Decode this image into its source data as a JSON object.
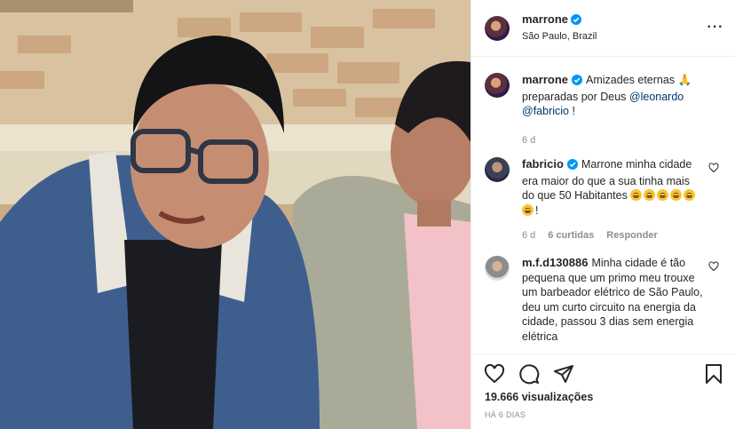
{
  "post": {
    "author": "marrone",
    "location": "São Paulo, Brazil",
    "more_icon": "more-options-icon",
    "caption": {
      "user": "marrone",
      "text_before": "Amizades eternas 🙏 preparadas por Deus ",
      "mention1": "@leonardo",
      "mention2": "@fabricio",
      "text_after": " !",
      "age": "6 d"
    },
    "comments": [
      {
        "user": "fabricio",
        "text": "Marrone minha cidade era maior do que a sua tinha mais do que 50 Habitantes",
        "text_end": "!",
        "age": "6 d",
        "likes": "6 curtidas",
        "reply": "Responder"
      },
      {
        "user": "m.f.d130886",
        "text": "Minha cidade é tão pequena que um primo meu trouxe um barbeador elétrico de São Paulo, deu um curto circuito na energia da cidade, passou 3 dias sem energia elétrica"
      }
    ],
    "views_count": "19.666",
    "views_label": "visualizações",
    "posted_ago": "HÁ 6 DIAS",
    "colors": {
      "verified": "#0095f6",
      "mention": "#00376b",
      "muted": "#8e8e8e"
    }
  }
}
